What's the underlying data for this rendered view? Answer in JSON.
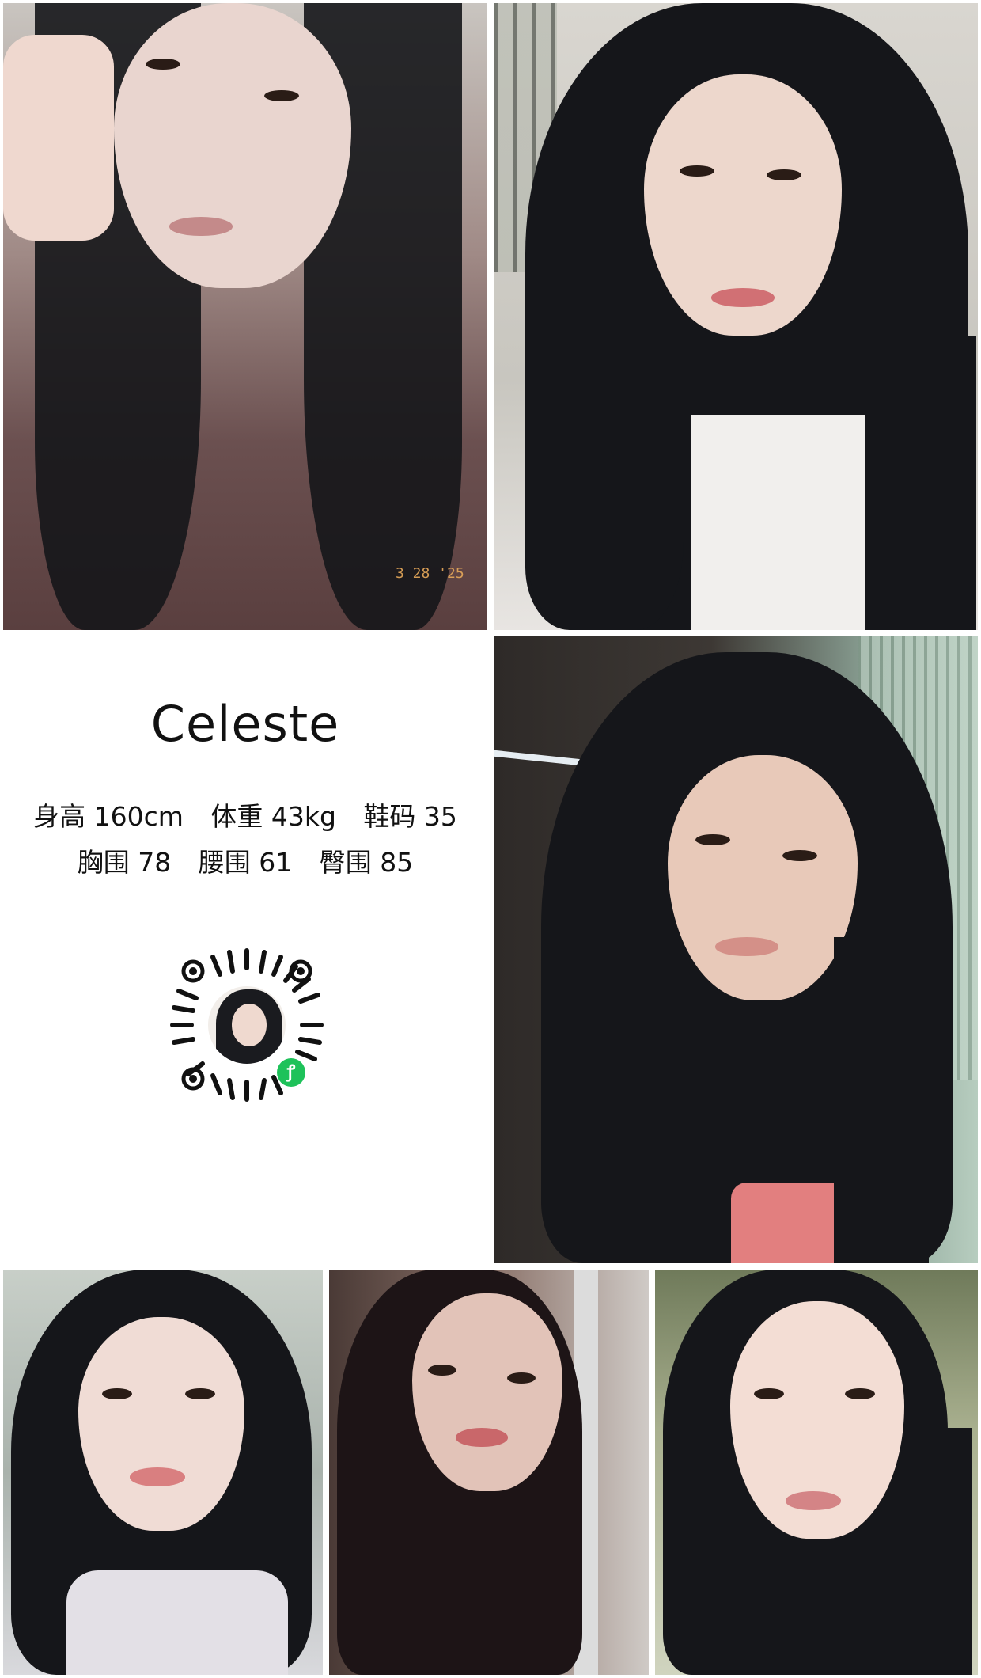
{
  "profile": {
    "name": "Celeste",
    "stats_line1": [
      "身高 160cm",
      "体重 43kg",
      "鞋码 35"
    ],
    "stats_line2": [
      "胸围 78",
      "腰围 61",
      "臀围 85"
    ]
  },
  "photos": {
    "photo1_date_stamp": "3 28 '25"
  },
  "qr": {
    "icon": "mini-program-icon",
    "badge_symbol": "ꝭ"
  },
  "colors": {
    "background": "#ffffff",
    "hair": "#15161a",
    "qr_badge": "#1ec25a"
  }
}
